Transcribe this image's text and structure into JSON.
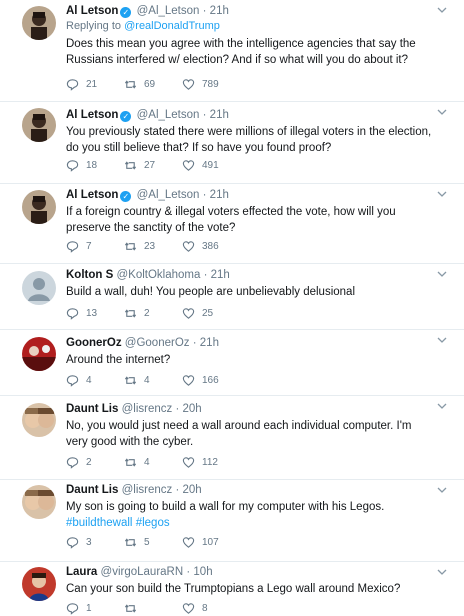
{
  "tweets": [
    {
      "name": "Al Letson",
      "verified": true,
      "handle": "@Al_Letson",
      "time": "21h",
      "reply_label": "Replying to",
      "reply_to": "@realDonaldTrump",
      "text": "Does this mean you agree with the intelligence agencies that say the Russians interfered w/ election? And if so what will you do about it?",
      "replies": "21",
      "retweets": "69",
      "likes": "789",
      "avatar": "person-photo"
    },
    {
      "name": "Al Letson",
      "verified": true,
      "handle": "@Al_Letson",
      "time": "21h",
      "text": "You previously stated there were millions of illegal voters in the election, do you still believe that? If so have you found proof?",
      "replies": "18",
      "retweets": "27",
      "likes": "491",
      "avatar": "person-photo"
    },
    {
      "name": "Al Letson",
      "verified": true,
      "handle": "@Al_Letson",
      "time": "21h",
      "text": "If a foreign country & illegal voters effected the vote, how will you preserve the sanctity of the vote?",
      "replies": "7",
      "retweets": "23",
      "likes": "386",
      "avatar": "person-photo"
    },
    {
      "name": "Kolton S",
      "verified": false,
      "handle": "@KoltOklahoma",
      "time": "21h",
      "text": "Build a wall, duh! You people are unbelievably delusional",
      "replies": "13",
      "retweets": "2",
      "likes": "25",
      "avatar": "default-egg"
    },
    {
      "name": "GoonerOz",
      "verified": false,
      "handle": "@GoonerOz",
      "time": "21h",
      "text": "Around the internet?",
      "replies": "4",
      "retweets": "4",
      "likes": "166",
      "avatar": "red-photo"
    },
    {
      "name": "Daunt Lis",
      "verified": false,
      "handle": "@lisrencz",
      "time": "20h",
      "text": "No, you would just need a wall around each individual computer. I'm very good with the cyber.",
      "replies": "2",
      "retweets": "4",
      "likes": "112",
      "avatar": "two-faces"
    },
    {
      "name": "Daunt Lis",
      "verified": false,
      "handle": "@lisrencz",
      "time": "20h",
      "text": "My son is going to build a wall for my computer with his Legos.",
      "hashtags": "#buildthewall",
      "hashtags2": "#legos",
      "replies": "3",
      "retweets": "5",
      "likes": "107",
      "avatar": "two-faces"
    },
    {
      "name": "Laura",
      "verified": false,
      "handle": "@virgoLauraRN",
      "time": "10h",
      "text": "Can your son build the Trumptopians a Lego wall around Mexico?",
      "replies": "1",
      "retweets": "",
      "likes": "8",
      "avatar": "woman-photo"
    }
  ],
  "colors": {
    "link": "#1da1f2",
    "secondary": "#657786",
    "border": "#e6ecf0"
  }
}
